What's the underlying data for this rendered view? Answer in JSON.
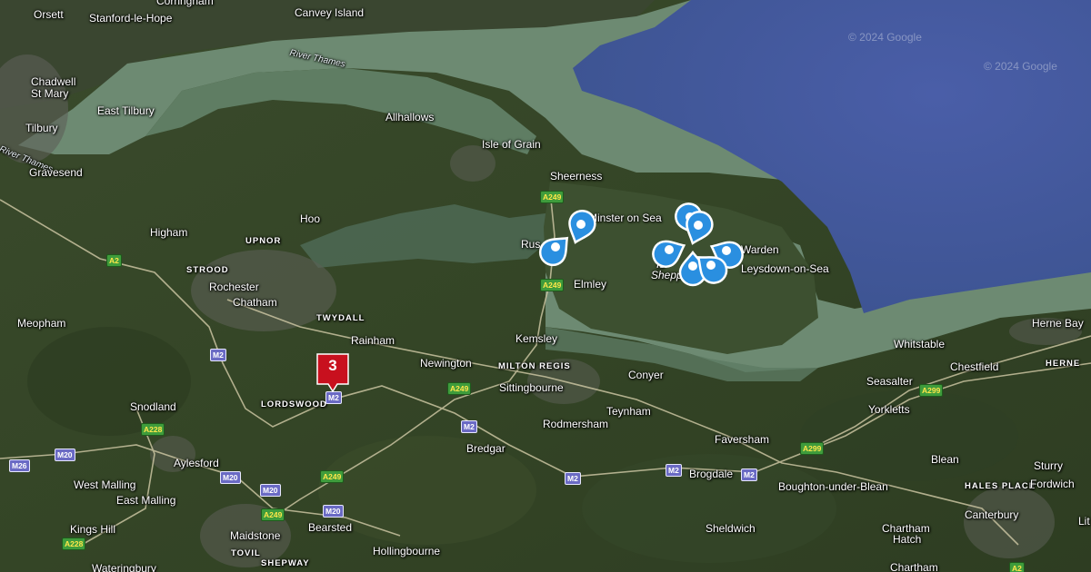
{
  "map": {
    "copyright": [
      "© 2024 Google",
      "© 2024 Google"
    ],
    "places": {
      "orsett": "Orsett",
      "stanford": "Stanford-le-Hope",
      "corringham": "Corringham",
      "canvey": "Canvey Island",
      "chadwell": "Chadwell",
      "st_mary": "St Mary",
      "tilbury": "Tilbury",
      "east_tilbury": "East Tilbury",
      "gravesend": "Gravesend",
      "allhallows": "Allhallows",
      "isle_of_grain": "Isle of Grain",
      "sheerness": "Sheerness",
      "minster": "Minster on Sea",
      "rushenden": "Rus",
      "warden": "Warden",
      "leysdown": "Leysdown-on-Sea",
      "isle_of_sheppey_1": "Is",
      "isle_of_sheppey_2": "Shepp",
      "hoo": "Hoo",
      "higham": "Higham",
      "upnor": "UPNOR",
      "strood": "STROOD",
      "rochester": "Rochester",
      "chatham": "Chatham",
      "twydall": "TWYDALL",
      "meopham": "Meopham",
      "rainham": "Rainham",
      "elmley": "Elmley",
      "kemsley": "Kemsley",
      "milton_regis": "MILTON REGIS",
      "newington": "Newington",
      "sittingbourne": "Sittingbourne",
      "conyer": "Conyer",
      "teynham": "Teynham",
      "rodmersham": "Rodmersham",
      "lordswood": "LORDSWOOD",
      "snodland": "Snodland",
      "faversham": "Faversham",
      "whitstable": "Whitstable",
      "herne_bay": "Herne Bay",
      "herne": "HERNE",
      "chestfield": "Chestfield",
      "seasalter": "Seasalter",
      "yorkletts": "Yorkletts",
      "blean": "Blean",
      "sturry": "Sturry",
      "hales_place": "HALES PLACE",
      "fordwich": "Fordwich",
      "canterbury": "Canterbury",
      "lit": "Lit",
      "boughton": "Boughton-under-Blean",
      "brogdale": "Brogdale",
      "bredgar": "Bredgar",
      "sheldwich": "Sheldwich",
      "chartham_hatch_1": "Chartham",
      "chartham_hatch_2": "Hatch",
      "chartham": "Chartham",
      "aylesford": "Aylesford",
      "west_malling": "West Malling",
      "east_malling": "East Malling",
      "kings_hill": "Kings Hill",
      "maidstone": "Maidstone",
      "tovil": "TOVIL",
      "shepway": "SHEPWAY",
      "bearsted": "Bearsted",
      "hollingbourne": "Hollingbourne",
      "wateringbury": "Wateringbury"
    },
    "rivers": {
      "thames_1": "River Thames",
      "thames_2": "River Thames"
    },
    "roads": {
      "a2_w": "A2",
      "a228_n": "A228",
      "a228_s": "A228",
      "a249_1": "A249",
      "a249_2": "A249",
      "a249_3": "A249",
      "a249_4": "A249",
      "a249_5": "A249",
      "a299_1": "A299",
      "a299_2": "A299",
      "a2_e": "A2",
      "m2_1": "M2",
      "m2_2": "M2",
      "m2_3": "M2",
      "m2_4": "M2",
      "m2_5": "M2",
      "m2_6": "M2",
      "m20_1": "M20",
      "m20_2": "M20",
      "m20_3": "M20",
      "m20_4": "M20",
      "m26": "M26"
    },
    "cluster": {
      "count": "3",
      "color": "#c8101e"
    },
    "pins": {
      "count": 8,
      "color": "#2a8fe0",
      "icon": "map-pin-icon"
    }
  }
}
